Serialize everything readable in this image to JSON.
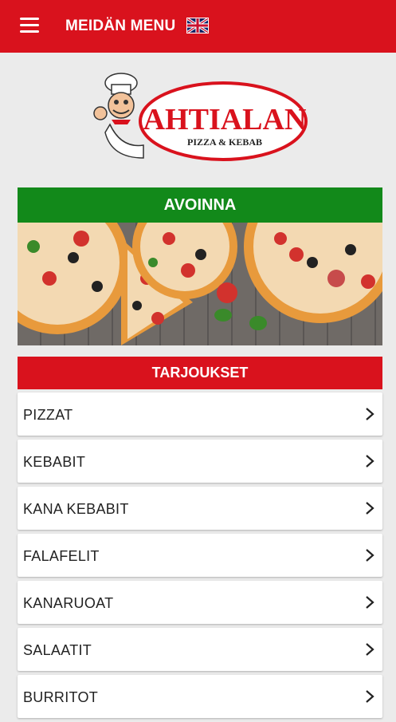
{
  "header": {
    "title": "MEIDÄN MENU",
    "menu_icon": "hamburger-menu-icon",
    "language_flag": "uk-flag-icon"
  },
  "logo": {
    "name": "AHTIALAN",
    "tagline": "PIZZA & KEBAB"
  },
  "status": {
    "label": "AVOINNA",
    "color": "#12891a"
  },
  "offers": {
    "label": "TARJOUKSET",
    "color": "#d9121d"
  },
  "menu": {
    "items": [
      {
        "label": "PIZZAT"
      },
      {
        "label": "KEBABIT"
      },
      {
        "label": "KANA KEBABIT"
      },
      {
        "label": "FALAFELIT"
      },
      {
        "label": "KANARUOAT"
      },
      {
        "label": "SALAATIT"
      },
      {
        "label": "BURRITOT"
      }
    ]
  },
  "colors": {
    "brand_red": "#d9121d",
    "open_green": "#12891a",
    "background": "#ebebeb"
  }
}
